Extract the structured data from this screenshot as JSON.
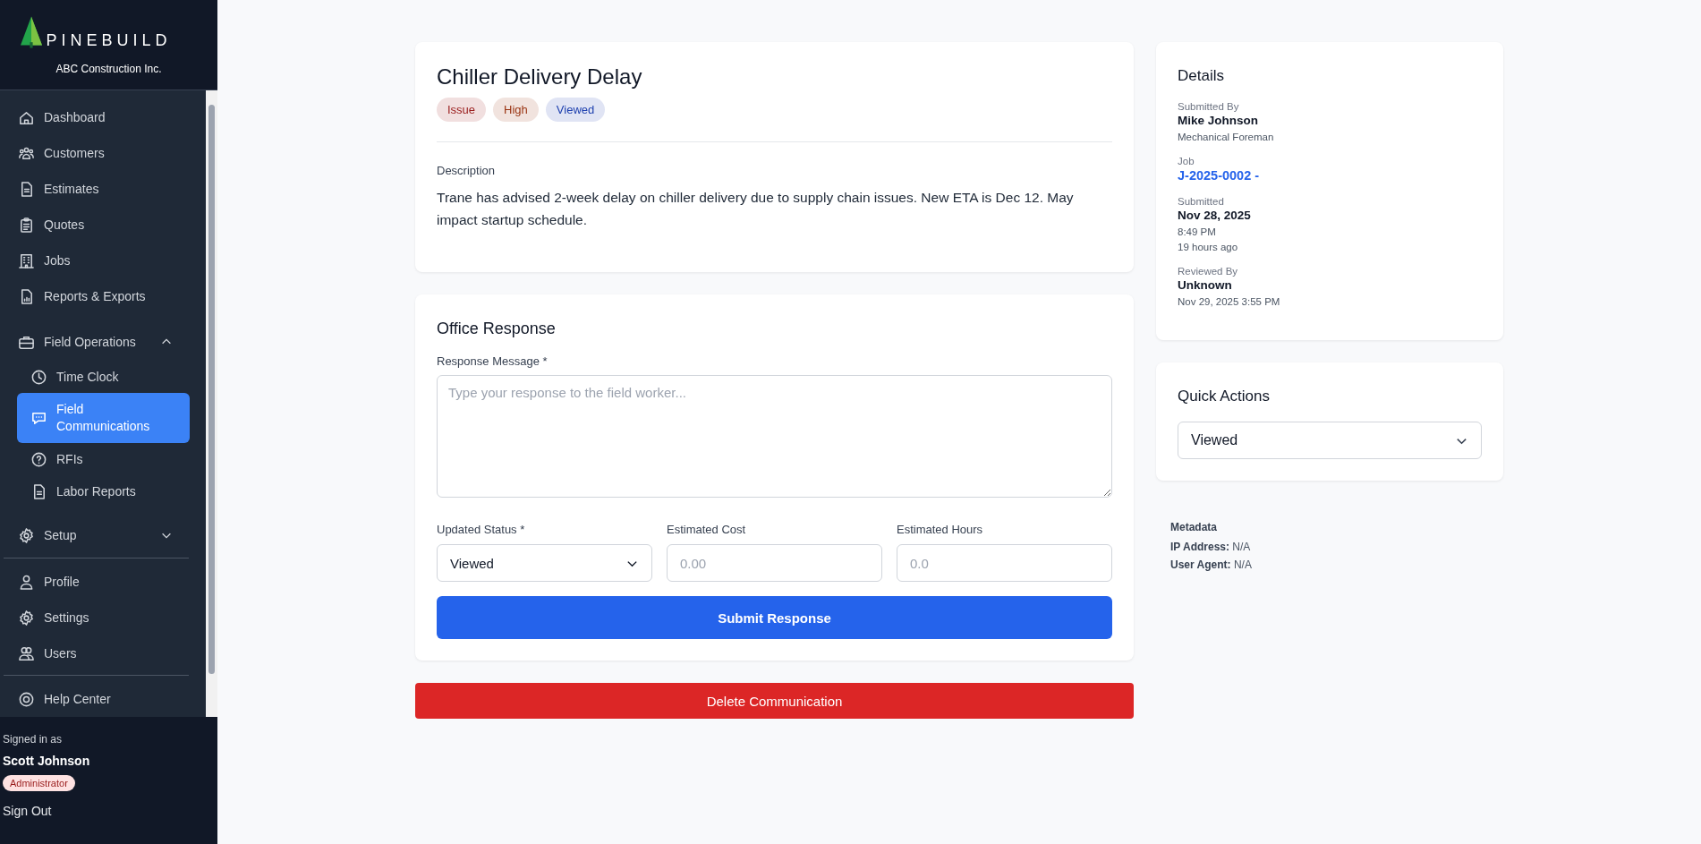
{
  "sidebar": {
    "brand": "PINEBUILD",
    "company": "ABC Construction Inc.",
    "items": [
      {
        "kind": "link",
        "label": "Dashboard",
        "selected": false
      },
      {
        "kind": "link",
        "label": "Customers",
        "selected": false
      },
      {
        "kind": "link",
        "label": "Estimates",
        "selected": false
      },
      {
        "kind": "link",
        "label": "Quotes",
        "selected": false
      },
      {
        "kind": "link",
        "label": "Jobs",
        "selected": false
      },
      {
        "kind": "link",
        "label": "Reports & Exports",
        "selected": false
      },
      {
        "kind": "group",
        "label": "Field Operations",
        "expanded": true,
        "children": [
          {
            "label": "Time Clock",
            "selected": false
          },
          {
            "label": "Field Communications",
            "selected": true
          },
          {
            "label": "RFIs",
            "selected": false
          },
          {
            "label": "Labor Reports",
            "selected": false
          }
        ]
      },
      {
        "kind": "group",
        "label": "Setup",
        "expanded": false
      },
      {
        "kind": "divider"
      },
      {
        "kind": "link",
        "label": "Profile",
        "selected": false
      },
      {
        "kind": "link",
        "label": "Settings",
        "selected": false
      },
      {
        "kind": "link",
        "label": "Users",
        "selected": false
      },
      {
        "kind": "divider"
      },
      {
        "kind": "link",
        "label": "Help Center",
        "selected": false
      }
    ],
    "user": {
      "caption": "Signed in as",
      "name": "Scott Johnson",
      "role": "Administrator",
      "sign_out": "Sign Out"
    }
  },
  "communication": {
    "title": "Chiller Delivery Delay",
    "tags": [
      {
        "label": "Issue",
        "color": "#991b1b"
      },
      {
        "label": "High",
        "color": "#9a3412"
      },
      {
        "label": "Viewed",
        "color": "#1e40af"
      }
    ],
    "description_label": "Description",
    "description": "Trane has advised 2-week delay on chiller delivery due to supply chain issues. New ETA is Dec 12. May impact startup schedule."
  },
  "response": {
    "title": "Office Response",
    "message_label": "Response Message *",
    "message_placeholder": "Type your response to the field worker...",
    "fields": [
      {
        "kind": "select",
        "label": "Updated Status *",
        "value": "Viewed"
      },
      {
        "kind": "input",
        "label": "Estimated Cost",
        "placeholder": "0.00"
      },
      {
        "kind": "input",
        "label": "Estimated Hours",
        "placeholder": "0.0"
      }
    ],
    "submit": "Submit Response"
  },
  "delete_button": "Delete Communication",
  "details": {
    "title": "Details",
    "fields": [
      {
        "kind": "text",
        "label": "Submitted By",
        "value": "Mike Johnson",
        "notes": [
          "Mechanical Foreman"
        ]
      },
      {
        "kind": "link",
        "label": "Job",
        "value": "J-2025-0002 -"
      },
      {
        "kind": "text",
        "label": "Submitted",
        "value": "Nov 28, 2025",
        "notes": [
          "8:49 PM",
          "19 hours ago"
        ]
      },
      {
        "kind": "text",
        "label": "Reviewed By",
        "value": "Unknown",
        "notes": [
          "Nov 29, 2025 3:55 PM"
        ]
      }
    ]
  },
  "quick_actions": {
    "title": "Quick Actions",
    "value": "Viewed"
  },
  "metadata": {
    "title": "Metadata",
    "lines": [
      "**IP Address:** N/A",
      "**User Agent:** N/A"
    ]
  }
}
